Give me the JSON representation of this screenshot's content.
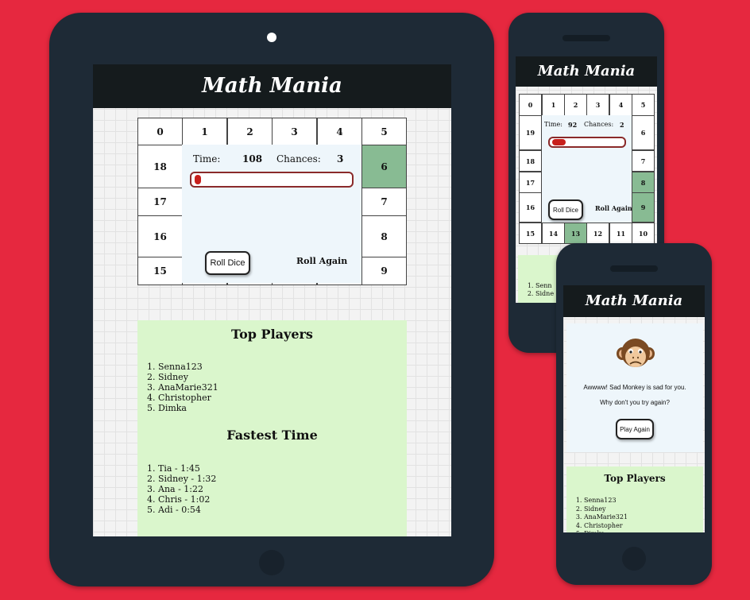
{
  "app_title": "Math Mania",
  "board_cells": [
    "0",
    "1",
    "2",
    "3",
    "4",
    "5",
    "6",
    "7",
    "8",
    "9",
    "10",
    "11",
    "12",
    "13",
    "14",
    "15",
    "16",
    "17",
    "18",
    "19"
  ],
  "tablet": {
    "time_label": "Time:",
    "time_value": "108",
    "chances_label": "Chances:",
    "chances_value": "3",
    "progress": 0.03,
    "roll_dice": "Roll Dice",
    "roll_again": "Roll Again",
    "top_players_title": "Top Players",
    "top_players": [
      "Senna123",
      "Sidney",
      "AnaMarie321",
      "Christopher",
      "Dimka"
    ],
    "fastest_time_title": "Fastest Time",
    "fastest_times": [
      "Tia - 1:45",
      "Sidney - 1:32",
      "Ana - 1:22",
      "Chris - 1:02",
      "Adi - 0:54"
    ],
    "highlight_cells": [
      "6"
    ]
  },
  "phone1": {
    "time_label": "Time:",
    "time_value": "92",
    "chances_label": "Chances:",
    "chances_value": "2",
    "progress": 0.08,
    "roll_dice": "Roll Dice",
    "roll_again": "Roll Again",
    "top_players_partial": [
      "Senn",
      "Sidne"
    ],
    "highlight_cells": [
      "8",
      "9",
      "13"
    ]
  },
  "phone2": {
    "sad_message": "Awwww! Sad Monkey is sad for you.",
    "retry_prompt": "Why don't you try again?",
    "play_again": "Play Again",
    "top_players_title": "Top Players",
    "top_players": [
      "Senna123",
      "Sidney",
      "AnaMarie321",
      "Christopher",
      "Dimka"
    ],
    "icon": "sad-monkey-icon"
  },
  "colors": {
    "background": "#e6283f",
    "device": "#1e2a36",
    "header": "#151b1d",
    "highlight_cell": "#88bb93",
    "panel": "#daf6cc",
    "progress": "#c8201c"
  }
}
